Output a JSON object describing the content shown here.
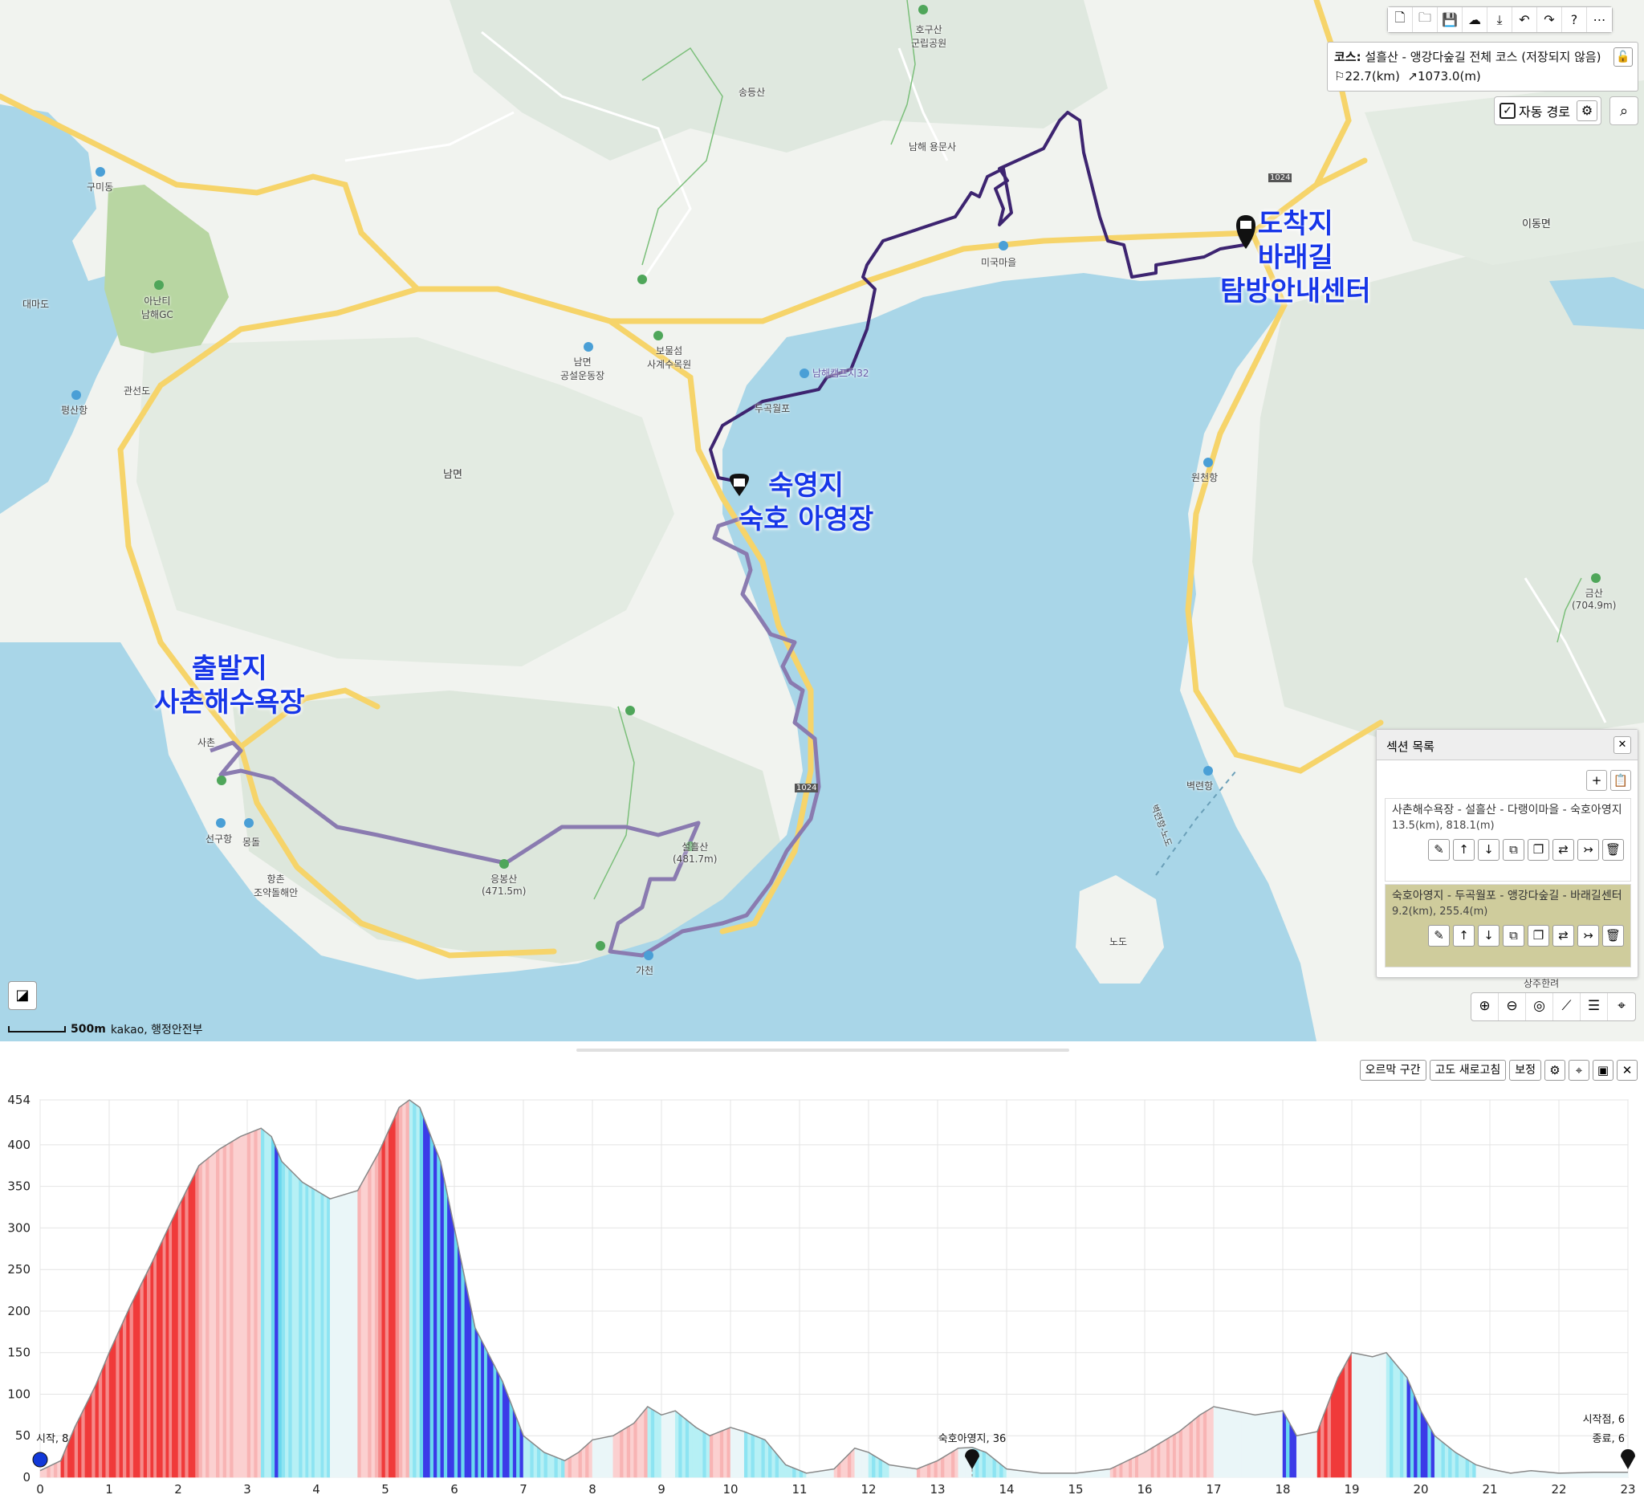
{
  "map": {
    "labels": [
      {
        "text": "호구산\n군립공원"
      },
      {
        "text": "송등산"
      },
      {
        "text": "남해 용문사"
      },
      {
        "text": "구미동"
      },
      {
        "text": "아난티\n남해GC"
      },
      {
        "text": "대마도"
      },
      {
        "text": "평산항"
      },
      {
        "text": "관선도"
      },
      {
        "text": "남면\n공설운동장"
      },
      {
        "text": "보물섬\n사계수목원"
      },
      {
        "text": "남해캠프지32"
      },
      {
        "text": "두곡월포"
      },
      {
        "text": "미국마을"
      },
      {
        "text": "이동면"
      },
      {
        "text": "원천항"
      },
      {
        "text": "남면"
      },
      {
        "text": "금산\n(704.9m)"
      },
      {
        "text": "사촌"
      },
      {
        "text": "선구항"
      },
      {
        "text": "몽돌"
      },
      {
        "text": "항촌\n조약돌해안"
      },
      {
        "text": "응봉산\n(471.5m)"
      },
      {
        "text": "설흘산\n(481.7m)"
      },
      {
        "text": "가천"
      },
      {
        "text": "벽련항"
      },
      {
        "text": "노도"
      },
      {
        "text": "벽련항-노도"
      },
      {
        "text": "상주한려"
      },
      {
        "text": "1024"
      },
      {
        "text": "1024"
      }
    ],
    "callouts": {
      "end": "도착지\n바래길\n탐방안내센터",
      "camp": "숙영지\n숙호 아영장",
      "start": "출발지\n사촌해수욕장"
    },
    "toolbar_icons": [
      "new-file-icon",
      "open-folder-icon",
      "save-icon",
      "cloud-upload-icon",
      "download-icon",
      "undo-icon",
      "redo-icon",
      "help-icon",
      "more-icon"
    ],
    "course": {
      "label": "코스:",
      "name": "설흘산 - 앵강다숲길 전체 코스 (저장되지 않음)",
      "distance": "22.7(km)",
      "elevation": "1073.0(m)"
    },
    "auto_route_label": "자동 경로",
    "scale_label": "500m",
    "attribution": "kakao, 행정안전부"
  },
  "sections": {
    "title": "섹션 목록",
    "items": [
      {
        "name": "사촌해수욕장 - 설흘산 - 다랭이마을 - 숙호아영지",
        "meta": "13.5(km), 818.1(m)"
      },
      {
        "name": "숙호아영지 - 두곡월포 - 앵강다숲길 - 바래길센터",
        "meta": "9.2(km), 255.4(m)"
      }
    ]
  },
  "chart_toolbar": {
    "uphill": "오르막 구간",
    "refresh": "고도 새로고침",
    "correct": "보정"
  },
  "chart_data": {
    "type": "area",
    "xlabel": "",
    "ylabel": "",
    "xlim": [
      0,
      23
    ],
    "ylim": [
      0,
      454
    ],
    "yticks": [
      0,
      50,
      100,
      150,
      200,
      250,
      300,
      350,
      400,
      454
    ],
    "xticks": [
      0,
      1,
      2,
      3,
      4,
      5,
      6,
      7,
      8,
      9,
      10,
      11,
      12,
      13,
      14,
      15,
      16,
      17,
      18,
      19,
      20,
      21,
      22,
      23
    ],
    "x": [
      0,
      0.3,
      0.5,
      0.8,
      1.0,
      1.3,
      1.6,
      2.0,
      2.3,
      2.6,
      2.9,
      3.2,
      3.35,
      3.5,
      3.8,
      4.2,
      4.6,
      4.9,
      5.2,
      5.35,
      5.5,
      5.8,
      6.0,
      6.3,
      6.7,
      7.0,
      7.3,
      7.6,
      7.8,
      8.0,
      8.3,
      8.6,
      8.8,
      9.0,
      9.2,
      9.5,
      9.7,
      10.0,
      10.2,
      10.5,
      10.8,
      11.1,
      11.5,
      11.8,
      12.0,
      12.3,
      12.7,
      13.0,
      13.3,
      13.5,
      13.7,
      14.0,
      14.5,
      15.0,
      15.5,
      16.0,
      16.5,
      16.8,
      17.0,
      17.3,
      17.6,
      18.0,
      18.2,
      18.5,
      18.8,
      19.0,
      19.3,
      19.5,
      19.8,
      20.0,
      20.2,
      20.5,
      20.8,
      21.0,
      21.3,
      21.6,
      22.0,
      22.5,
      23.0
    ],
    "y": [
      8,
      20,
      60,
      110,
      150,
      205,
      255,
      325,
      375,
      395,
      410,
      420,
      410,
      380,
      355,
      335,
      345,
      390,
      445,
      454,
      445,
      380,
      300,
      180,
      115,
      50,
      30,
      20,
      30,
      45,
      50,
      65,
      85,
      75,
      80,
      60,
      50,
      60,
      55,
      45,
      15,
      5,
      10,
      35,
      30,
      15,
      10,
      20,
      35,
      36,
      30,
      10,
      5,
      5,
      10,
      30,
      55,
      75,
      85,
      80,
      75,
      80,
      50,
      55,
      120,
      150,
      145,
      150,
      120,
      80,
      50,
      30,
      15,
      10,
      5,
      8,
      5,
      6,
      6
    ],
    "markers": [
      {
        "x": 0,
        "label": "시작, 8"
      },
      {
        "x": 13.5,
        "label": "숙호아영지, 36"
      },
      {
        "x": 23,
        "label": "시작점, 6"
      },
      {
        "x": 23,
        "label": "종료, 6"
      }
    ],
    "grid": true,
    "colors": {
      "up": "#f03a3a",
      "up_light": "#fbd0d0",
      "down": "#3b3be8",
      "down_light": "#b6f0f5",
      "line": "#888888"
    }
  }
}
